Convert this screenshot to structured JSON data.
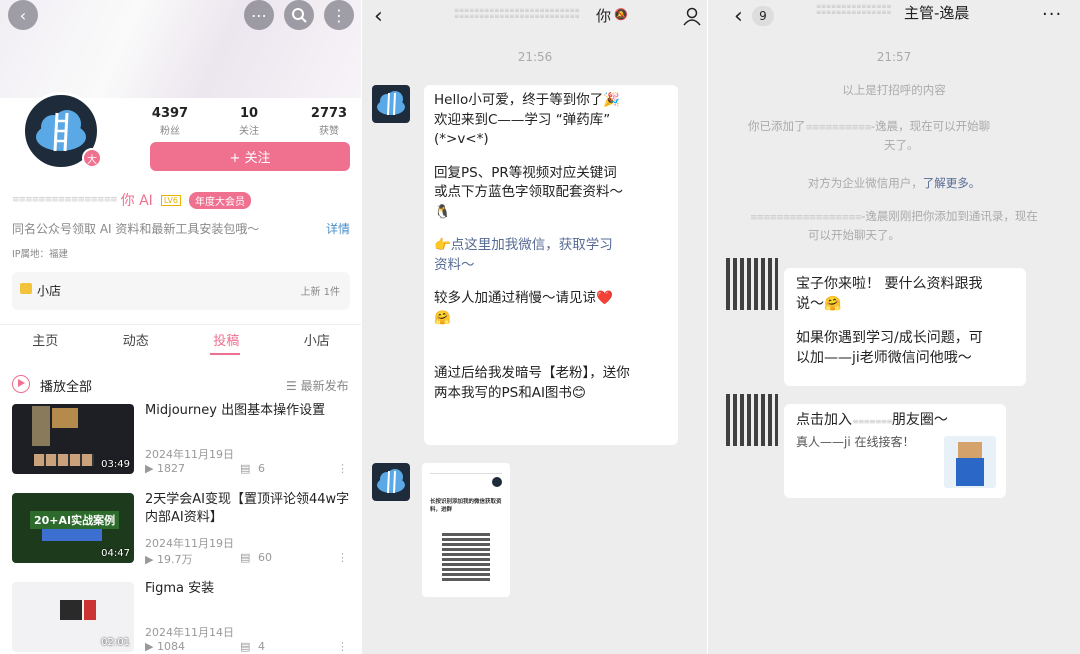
{
  "profile": {
    "stats": [
      {
        "num": "4397",
        "label": "粉丝"
      },
      {
        "num": "10",
        "label": "关注"
      },
      {
        "num": "2773",
        "label": "获赞"
      }
    ],
    "avatar_badge": "大",
    "follow_label": "+ 关注",
    "name_visible": "你 AI",
    "name_tag": "年度大会员",
    "bio": "同名公众号领取 AI 资料和最新工具安装包哦～",
    "bio_detail": "详情",
    "ip": "IP属地：福建",
    "shop_label": "小店",
    "shop_count": "上新 1件",
    "tabs": [
      "主页",
      "动态",
      "投稿",
      "小店"
    ],
    "active_tab_color": "#f0708f",
    "play_all": "播放全部",
    "sort_label": "最新发布",
    "videos": [
      {
        "title": "Midjourney 出图基本操作设置",
        "date": "2024年11月19日",
        "plays": "1827",
        "comments": "6",
        "duration": "03:49"
      },
      {
        "title": "2天学会AI变现【置顶评论领44w字内部AI资料】",
        "date": "2024年11月19日",
        "plays": "19.7万",
        "comments": "60",
        "duration": "04:47",
        "thumb_text": "20+AI实战案例"
      },
      {
        "title": "Figma 安装",
        "date": "2024年11月14日",
        "plays": "1084",
        "comments": "4",
        "duration": "02:01"
      }
    ]
  },
  "chat1": {
    "title": "你",
    "time": "21:56",
    "message_lines": [
      "Hello小可爱，终于等到你了🎉",
      "欢迎来到C——学习 “弹药库”",
      "(*>v<*)",
      "",
      "回复PS、PR等视频对应关键词",
      "或点下方蓝色字领取配套资料～",
      "🐧",
      "",
      "👉点这里加我微信，获取学习",
      "资料～",
      "",
      "较多人加通过稍慢～请见谅❤️",
      "🤗",
      "",
      "",
      "通过后给我发暗号【老粉】，送你",
      "两本我写的PS和AI图书😊"
    ],
    "card_text": "长按识别添加我的微信获取资料，进群"
  },
  "chat2": {
    "unread": "9",
    "title": "主管-逸晨",
    "time": "21:57",
    "sys1": "以上是打招呼的内容",
    "sys2a": "你已添加了",
    "sys2b": "-逸晨，现在可以开始聊",
    "sys2c": "天了。",
    "sys3a": "对方为企业微信用户，",
    "sys3_link": "了解更多。",
    "sys4a": "-逸晨刚刚把你添加到通讯录，现在",
    "sys4b": "可以开始聊天了。",
    "msg1": [
      "宝子你来啦！ 要什么资料跟我",
      "说～🤗",
      "",
      "如果你遇到学习/成长问题，可",
      "以加——ji老师微信问他哦～"
    ],
    "msg2a": "点击加入",
    "msg2b": "朋友圈～",
    "msg2c": "真人——ji 在线接客！",
    "link_color": "#576b95"
  }
}
